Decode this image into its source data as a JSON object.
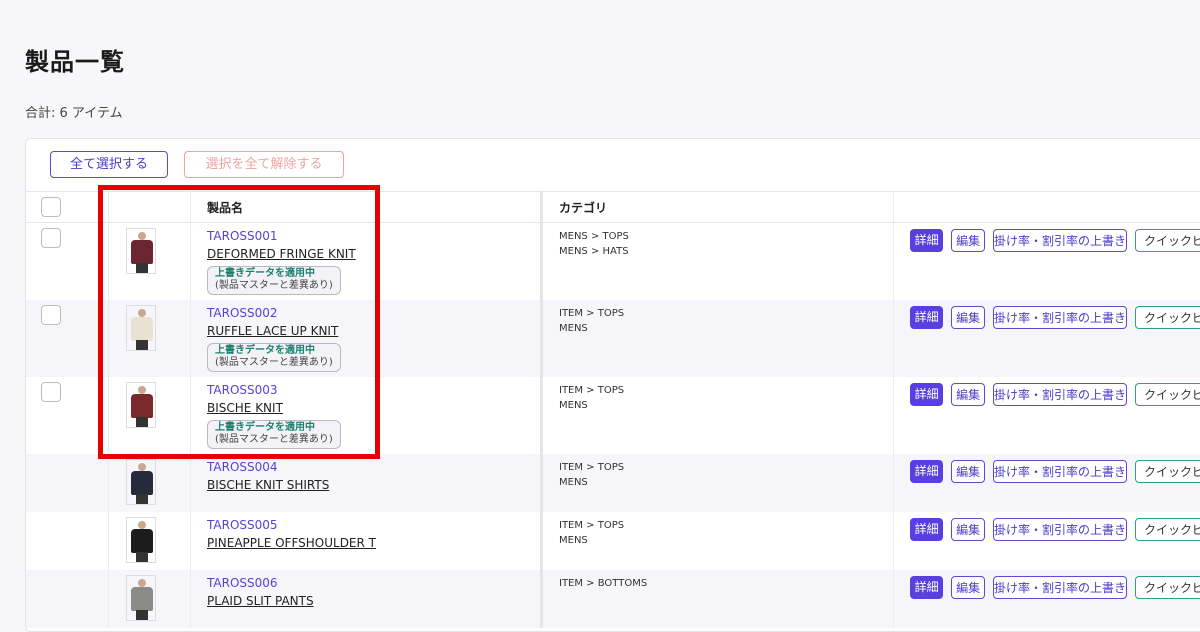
{
  "page": {
    "title": "製品一覧",
    "total_label": "合計:",
    "total_count": "6 アイテム"
  },
  "toolbar": {
    "select_all": "全て選択する",
    "deselect_all": "選択を全て解除する"
  },
  "table": {
    "headers": {
      "name": "製品名",
      "category": "カテゴリ"
    },
    "rows": [
      {
        "code": "TAROSS001",
        "name": "DEFORMED FRINGE KNIT",
        "override": true,
        "cat1": "MENS > TOPS",
        "cat2": "MENS > HATS",
        "garment_color": "#6b2630"
      },
      {
        "code": "TAROSS002",
        "name": "RUFFLE LACE UP KNIT",
        "override": true,
        "cat1": "ITEM > TOPS",
        "cat2": "MENS",
        "garment_color": "#e9e2d2"
      },
      {
        "code": "TAROSS003",
        "name": "BISCHE KNIT",
        "override": true,
        "cat1": "ITEM > TOPS",
        "cat2": "MENS",
        "garment_color": "#7a2a2a"
      },
      {
        "code": "TAROSS004",
        "name": "BISCHE KNIT SHIRTS",
        "override": false,
        "cat1": "ITEM > TOPS",
        "cat2": "MENS",
        "garment_color": "#252b3a"
      },
      {
        "code": "TAROSS005",
        "name": "PINEAPPLE OFFSHOULDER T",
        "override": false,
        "cat1": "ITEM > TOPS",
        "cat2": "MENS",
        "garment_color": "#1c1c1c"
      },
      {
        "code": "TAROSS006",
        "name": "PLAID SLIT PANTS",
        "override": false,
        "cat1": "ITEM > BOTTOMS",
        "cat2": "",
        "garment_color": "#8a8a86"
      }
    ],
    "override_line1": "上書きデータを適用中",
    "override_line2": "(製品マスターと差異あり)",
    "actions": {
      "detail": "詳細",
      "edit": "編集",
      "rate": "掛け率・割引率の上書き",
      "quick": "クイックビ"
    }
  },
  "colors": {
    "accent": "#5a3fe0",
    "highlight": "#e60000",
    "override_text": "#1e7f6f"
  }
}
